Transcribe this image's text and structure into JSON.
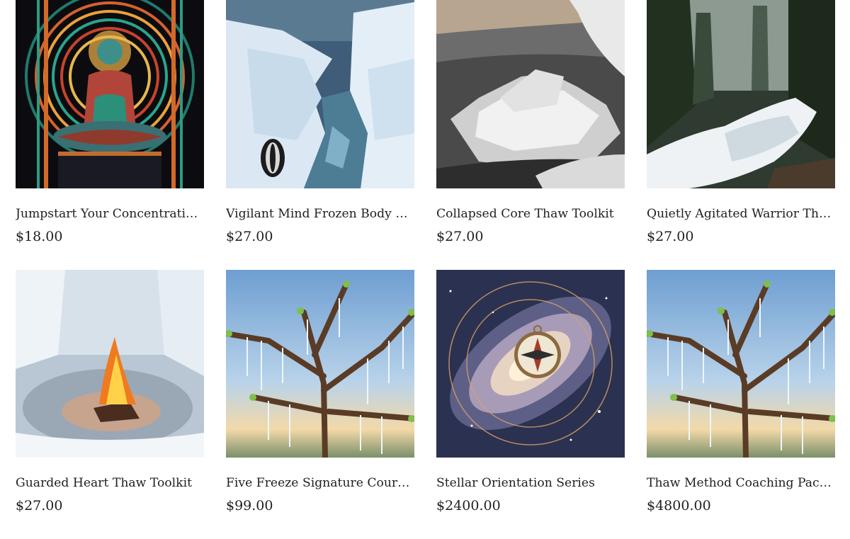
{
  "products": [
    {
      "title": "Jumpstart Your Concentration Power Course",
      "price": "$18.00",
      "image": "meditating-figure-art"
    },
    {
      "title": "Vigilant Mind Frozen Body Thaw Toolkit",
      "price": "$27.00",
      "image": "ice-crevasse"
    },
    {
      "title": "Collapsed Core Thaw Toolkit",
      "price": "$27.00",
      "image": "melting-ice-shore"
    },
    {
      "title": "Quietly Agitated Warrior Thaw Toolkit",
      "price": "$27.00",
      "image": "snowy-forest-stream"
    },
    {
      "title": "Guarded Heart Thaw Toolkit",
      "price": "$27.00",
      "image": "fire-on-ice"
    },
    {
      "title": "Five Freeze Signature Courses Bundle",
      "price": "$99.00",
      "image": "icicle-branches"
    },
    {
      "title": "Stellar Orientation Series",
      "price": "$2400.00",
      "image": "galaxy-compass"
    },
    {
      "title": "Thaw Method Coaching Package",
      "price": "$4800.00",
      "image": "icicle-branches"
    }
  ]
}
